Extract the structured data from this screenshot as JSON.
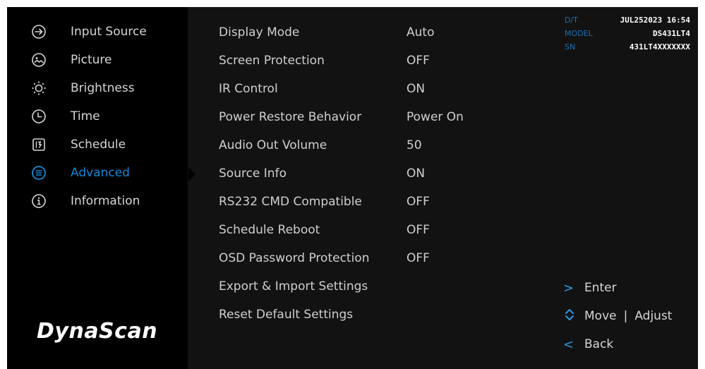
{
  "brand": "DynaScan",
  "sidebar": {
    "items": [
      {
        "label": "Input Source",
        "icon": "input-source-icon"
      },
      {
        "label": "Picture",
        "icon": "picture-icon"
      },
      {
        "label": "Brightness",
        "icon": "brightness-icon"
      },
      {
        "label": "Time",
        "icon": "clock-icon"
      },
      {
        "label": "Schedule",
        "icon": "schedule-icon"
      },
      {
        "label": "Advanced",
        "icon": "advanced-icon",
        "active": true
      },
      {
        "label": "Information",
        "icon": "information-icon"
      }
    ]
  },
  "settings": [
    {
      "label": "Display Mode",
      "value": "Auto"
    },
    {
      "label": "Screen Protection",
      "value": "OFF"
    },
    {
      "label": "IR Control",
      "value": "ON"
    },
    {
      "label": "Power Restore Behavior",
      "value": "Power On"
    },
    {
      "label": "Audio Out Volume",
      "value": "50"
    },
    {
      "label": "Source Info",
      "value": "ON"
    },
    {
      "label": "RS232 CMD Compatible",
      "value": "OFF"
    },
    {
      "label": "Schedule Reboot",
      "value": "OFF"
    },
    {
      "label": "OSD Password Protection",
      "value": "OFF"
    },
    {
      "label": "Export & Import Settings",
      "value": ""
    },
    {
      "label": "Reset Default Settings",
      "value": ""
    }
  ],
  "info": {
    "dt_label": "D/T",
    "dt_value": "JUL252023 16:54",
    "model_label": "MODEL",
    "model_value": "DS431LT4",
    "sn_label": "SN",
    "sn_value": "431LT4XXXXXXX"
  },
  "help": {
    "enter_icon": ">",
    "enter_label": "Enter",
    "move_label": "Move",
    "separator": "|",
    "adjust_label": "Adjust",
    "back_icon": "<",
    "back_label": "Back"
  },
  "colors": {
    "accent": "#1488d6",
    "background": "#121212",
    "sidebar": "#000000",
    "text": "#cfcfcf"
  }
}
